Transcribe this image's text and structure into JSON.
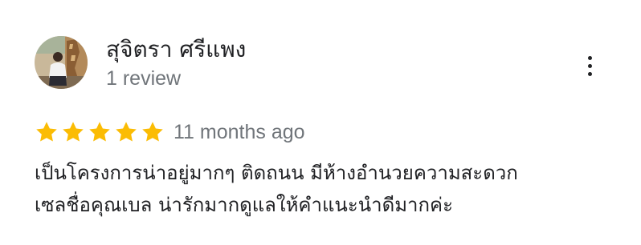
{
  "reviewer": {
    "name": "สุจิตรา ศรีแพง",
    "review_count": "1 review",
    "avatar_icon": "reviewer-photo"
  },
  "review": {
    "rating": 5,
    "max_rating": 5,
    "star_color": "#fbbc04",
    "timestamp": "11 months ago",
    "text_lines": [
      "เป็นโครงการน่าอยู่มากๆ ติดถนน มีห้างอำนวยความสะดวก",
      "เซลชื่อคุณเบล น่ารักมากดูแลให้คำแนะนำดีมากค่ะ"
    ]
  },
  "actions": {
    "menu_icon": "more-vert-icon"
  }
}
